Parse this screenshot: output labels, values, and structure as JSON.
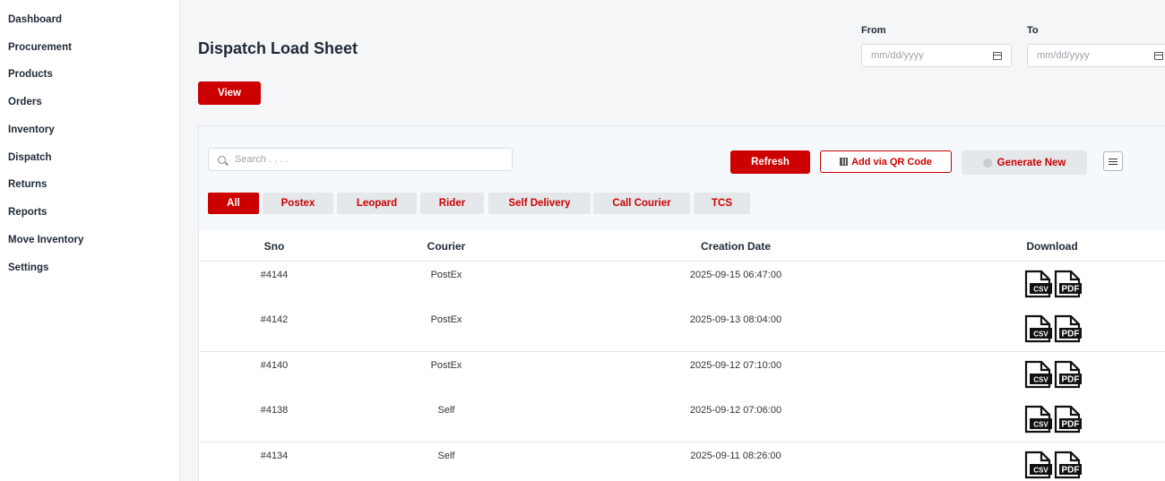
{
  "sidebar": {
    "items": [
      {
        "label": "Dashboard"
      },
      {
        "label": "Procurement"
      },
      {
        "label": "Products"
      },
      {
        "label": "Orders"
      },
      {
        "label": "Inventory"
      },
      {
        "label": "Dispatch"
      },
      {
        "label": "Returns"
      },
      {
        "label": "Reports"
      },
      {
        "label": "Move Inventory"
      },
      {
        "label": "Settings"
      }
    ]
  },
  "header": {
    "title": "Dispatch Load Sheet",
    "view_label": "View",
    "from_label": "From",
    "to_label": "To",
    "from_placeholder": "mm/dd/yyyy",
    "to_placeholder": "mm/dd/yyyy"
  },
  "toolbar": {
    "search_placeholder": "Search . . . .",
    "refresh_label": "Refresh",
    "qr_label": "Add via QR Code",
    "generate_label": "Generate New"
  },
  "tabs": [
    {
      "label": "All",
      "active": true
    },
    {
      "label": "Postex"
    },
    {
      "label": "Leopard"
    },
    {
      "label": "Rider"
    },
    {
      "label": "Self Delivery"
    },
    {
      "label": "Call Courier"
    },
    {
      "label": "TCS"
    }
  ],
  "table": {
    "columns": [
      "Sno",
      "Courier",
      "Creation Date",
      "Download"
    ],
    "rows": [
      {
        "sno": "#4144",
        "courier": "PostEx",
        "date": "2025-09-15 06:47:00"
      },
      {
        "sno": "#4142",
        "courier": "PostEx",
        "date": "2025-09-13 08:04:00"
      },
      {
        "sno": "#4140",
        "courier": "PostEx",
        "date": "2025-09-12 07:10:00"
      },
      {
        "sno": "#4138",
        "courier": "Self",
        "date": "2025-09-12 07:06:00"
      },
      {
        "sno": "#4134",
        "courier": "Self",
        "date": "2025-09-11 08:26:00"
      }
    ],
    "download_icons": {
      "csv": "CSV",
      "pdf": "PDF"
    }
  },
  "colors": {
    "accent": "#cc0000",
    "tab_bg": "#e4e8ea",
    "page_bg": "#f4f6f8"
  }
}
